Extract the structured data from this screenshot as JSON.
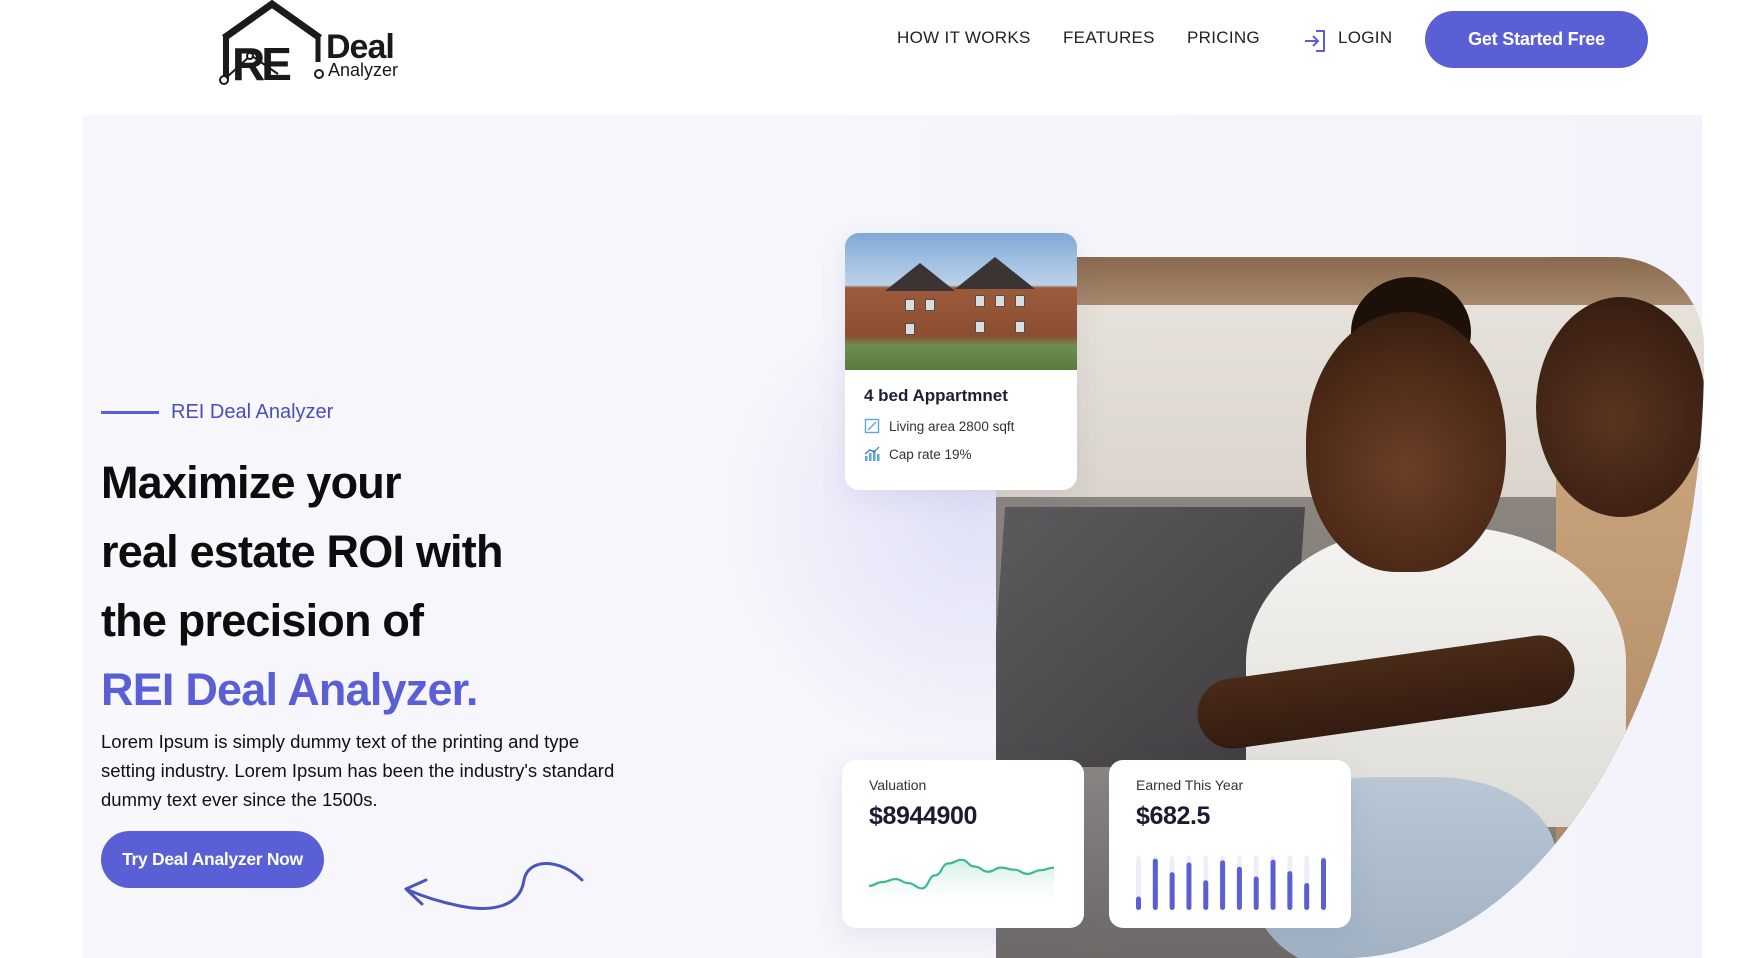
{
  "header": {
    "logo": {
      "mark": "RE",
      "word_top": "Deal",
      "word_bottom": "Analyzer"
    },
    "nav": [
      {
        "label": "HOW IT WORKS"
      },
      {
        "label": "FEATURES"
      },
      {
        "label": "PRICING"
      },
      {
        "label": "LOGIN"
      }
    ],
    "cta_label": "Get Started Free"
  },
  "hero": {
    "eyebrow": "REI Deal Analyzer",
    "headline_lines": [
      "Maximize your",
      "real estate ROI with",
      "the precision of"
    ],
    "headline_accent": "REI Deal Analyzer.",
    "description": "Lorem Ipsum is simply dummy text of the printing and type setting industry. Lorem Ipsum has been the industry's standard dummy text ever since the 1500s.",
    "cta_label": "Try Deal Analyzer Now"
  },
  "property_card": {
    "title": "4 bed Appartmnet",
    "living_area": "Living area 2800 sqft",
    "cap_rate": "Cap rate 19%"
  },
  "valuation_card": {
    "label": "Valuation",
    "value": "$8944900",
    "sparkline": [
      0.35,
      0.42,
      0.48,
      0.4,
      0.3,
      0.55,
      0.78,
      0.85,
      0.72,
      0.62,
      0.7,
      0.66,
      0.58,
      0.65,
      0.7
    ]
  },
  "earned_card": {
    "label": "Earned This Year",
    "value": "$682.5",
    "bars": [
      0.25,
      0.95,
      0.7,
      0.88,
      0.55,
      0.92,
      0.8,
      0.62,
      0.93,
      0.72,
      0.5,
      0.96
    ]
  },
  "colors": {
    "accent": "#5a5fd6",
    "spark_line": "#3bb89a",
    "spark_fill": "#cfeee4",
    "bar": "#5a5fd6"
  },
  "icons": {
    "login": "login-arrow-icon",
    "living_area": "area-icon",
    "cap_rate": "chart-bars-icon"
  }
}
